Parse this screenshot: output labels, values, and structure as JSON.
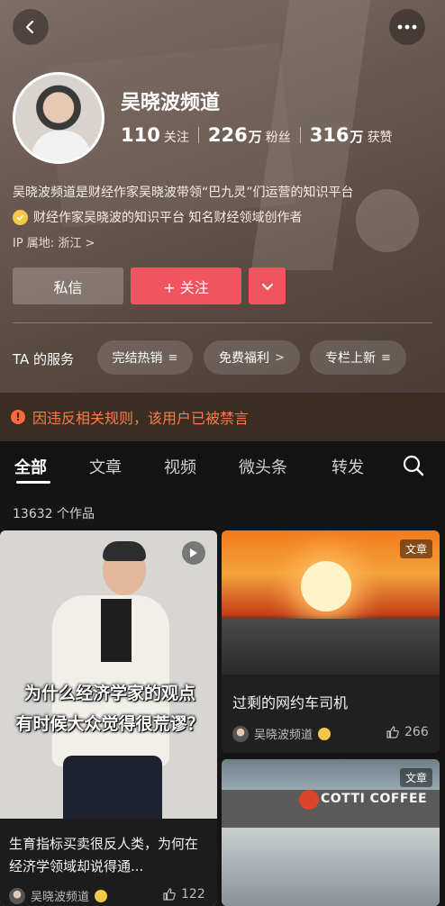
{
  "profile": {
    "name": "吴晓波频道",
    "stats": [
      {
        "num": "110",
        "unit": "",
        "label": "关注"
      },
      {
        "num": "226",
        "unit": "万",
        "label": "粉丝"
      },
      {
        "num": "316",
        "unit": "万",
        "label": "获赞"
      }
    ],
    "description": "吴晓波频道是财经作家吴晓波带领“巴九灵”们运营的知识平台",
    "certification": "财经作家吴晓波的知识平台 知名财经领域创作者",
    "ip_location": "IP 属地: 浙江 >"
  },
  "actions": {
    "message_label": "私信",
    "follow_label": "+ 关注"
  },
  "services": {
    "title": "TA 的服务",
    "chips": [
      {
        "label": "完结热销",
        "icon": "≡"
      },
      {
        "label": "免费福利",
        "icon": ">"
      },
      {
        "label": "专栏上新",
        "icon": "≡"
      }
    ]
  },
  "banner": {
    "icon": "!",
    "text": "因违反相关规则，该用户已被禁言"
  },
  "tabs": [
    "全部",
    "文章",
    "视频",
    "微头条",
    "转发"
  ],
  "active_tab": "全部",
  "works_count": "13632 个作品",
  "cards": [
    {
      "overlay_line1": "为什么经济学家的观点",
      "overlay_line2": "有时候大众觉得很荒谬？",
      "title": "生育指标买卖很反人类，为何在经济学领域却说得通...",
      "author": "吴晓波频道",
      "likes": "122"
    },
    {
      "tag": "文章",
      "title": "过剩的网约车司机",
      "author": "吴晓波频道",
      "likes": "266"
    },
    {
      "tag": "文章",
      "sign": "COTTI COFFEE"
    }
  ],
  "colors": {
    "accent": "#f0545e",
    "warning": "#ff7a4a",
    "banner_bg": "#3a2d22",
    "badge": "#f5c84a"
  },
  "icons": [
    "back-icon",
    "more-icon",
    "chevron-down-icon",
    "warning-icon",
    "search-icon",
    "play-icon",
    "like-icon",
    "verified-badge-icon"
  ]
}
